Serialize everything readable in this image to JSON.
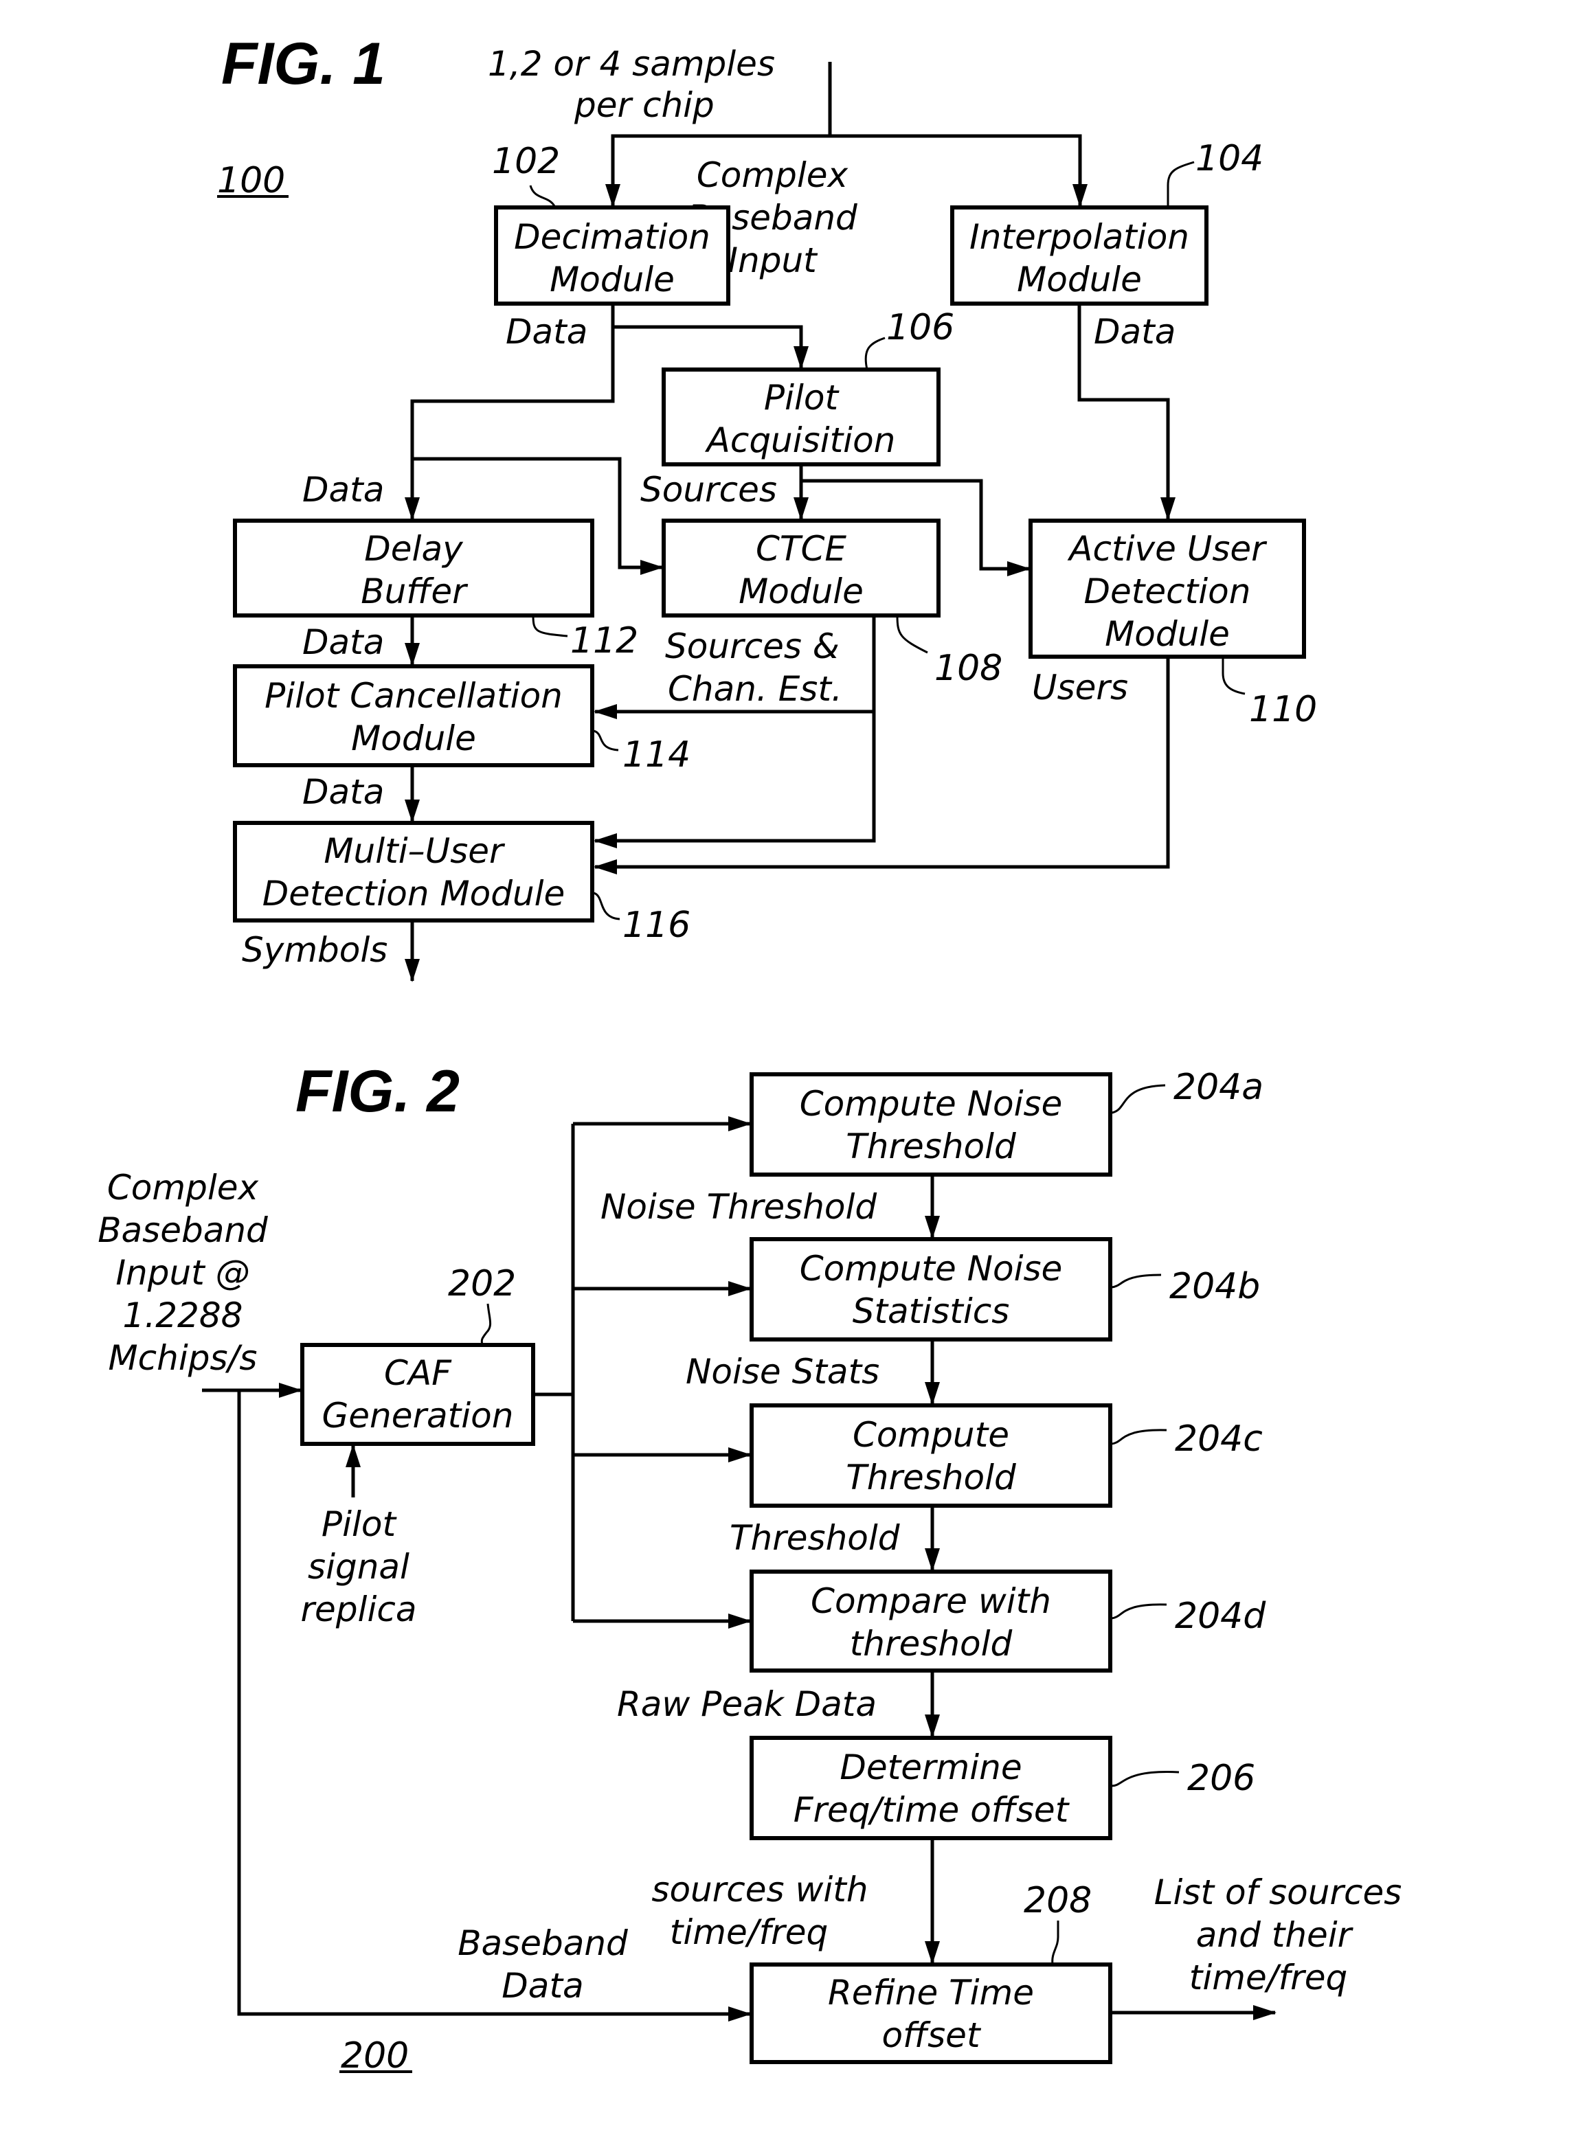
{
  "fig1": {
    "title": "FIG. 1",
    "ref_id": "100",
    "input_label": [
      "1,2 or 4 samples",
      "per chip"
    ],
    "center_label": [
      "Complex",
      "Baseband",
      "Input"
    ],
    "blocks": {
      "decimation": {
        "ref": "102",
        "lines": [
          "Decimation",
          "Module"
        ]
      },
      "interpolation": {
        "ref": "104",
        "lines": [
          "Interpolation",
          "Module"
        ]
      },
      "pilot_acquisition": {
        "ref": "106",
        "lines": [
          "Pilot",
          "Acquisition"
        ]
      },
      "ctce": {
        "ref": "108",
        "lines": [
          "CTCE",
          "Module"
        ]
      },
      "active_user": {
        "ref": "110",
        "lines": [
          "Active User",
          "Detection",
          "Module"
        ]
      },
      "delay_buffer": {
        "ref": "112",
        "lines": [
          "Delay",
          "Buffer"
        ]
      },
      "pilot_cancellation": {
        "ref": "114",
        "lines": [
          "Pilot Cancellation",
          "Module"
        ]
      },
      "mud": {
        "ref": "116",
        "lines": [
          "Multi–User",
          "Detection Module"
        ]
      }
    },
    "signals": {
      "data_decim": "Data",
      "data_interp": "Data",
      "data_delay_in": "Data",
      "sources": "Sources",
      "data_delay_out": "Data",
      "sources_chan": [
        "Sources &",
        "Chan. Est."
      ],
      "users": "Users",
      "data_pc_out": "Data",
      "symbols": "Symbols"
    }
  },
  "fig2": {
    "title": "FIG. 2",
    "ref_id": "200",
    "input_label": [
      "Complex",
      "Baseband",
      "Input @",
      "1.2288",
      "Mchips/s"
    ],
    "pilot_label": [
      "Pilot",
      "signal",
      "replica"
    ],
    "blocks": {
      "caf": {
        "ref": "202",
        "lines": [
          "CAF",
          "Generation"
        ]
      },
      "noise_threshold": {
        "ref": "204a",
        "lines": [
          "Compute Noise",
          "Threshold"
        ]
      },
      "noise_stats": {
        "ref": "204b",
        "lines": [
          "Compute Noise",
          "Statistics"
        ]
      },
      "compute_threshold": {
        "ref": "204c",
        "lines": [
          "Compute",
          "Threshold"
        ]
      },
      "compare": {
        "ref": "204d",
        "lines": [
          "Compare with",
          "threshold"
        ]
      },
      "determine": {
        "ref": "206",
        "lines": [
          "Determine",
          "Freq/time offset"
        ]
      },
      "refine": {
        "ref": "208",
        "lines": [
          "Refine Time",
          "offset"
        ]
      }
    },
    "signals": {
      "noise_threshold": "Noise Threshold",
      "noise_stats": "Noise Stats",
      "threshold": "Threshold",
      "raw_peak": "Raw Peak Data",
      "sources_tf": [
        "sources with",
        "time/freq"
      ],
      "baseband_data": [
        "Baseband",
        "Data"
      ],
      "output": [
        "List of sources",
        "and their",
        "time/freq"
      ]
    }
  }
}
